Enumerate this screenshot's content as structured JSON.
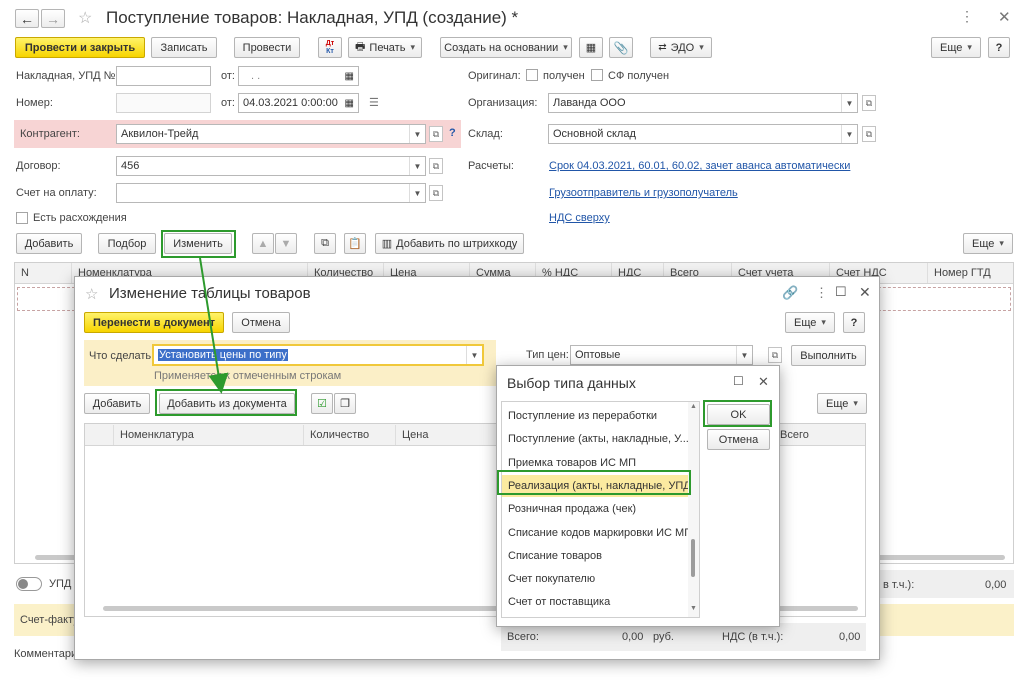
{
  "main": {
    "title": "Поступление товаров: Накладная, УПД (создание) *",
    "toolbar": {
      "post_close": "Провести и закрыть",
      "save": "Записать",
      "post": "Провести",
      "print": "Печать",
      "create_based": "Создать на основании",
      "edo": "ЭДО",
      "more": "Еще",
      "help": "?",
      "dtkt_top": "Дт",
      "dtkt_bottom": "Кт"
    },
    "fields": {
      "invoice_label": "Накладная, УПД №:",
      "invoice_value": "",
      "from_label": "от:",
      "invoice_date": ". .",
      "number_label": "Номер:",
      "number_value": "",
      "date_value": "04.03.2021 0:00:00",
      "counterparty_label": "Контрагент:",
      "counterparty_value": "Аквилон-Трейд",
      "contract_label": "Договор:",
      "contract_value": "456",
      "payment_invoice_label": "Счет на оплату:",
      "payment_invoice_value": "",
      "discrepancies_label": "Есть расхождения",
      "original_label": "Оригинал:",
      "received_label": "получен",
      "sf_received_label": "СФ получен",
      "organization_label": "Организация:",
      "organization_value": "Лаванда ООО",
      "warehouse_label": "Склад:",
      "warehouse_value": "Основной склад",
      "settlements_label": "Расчеты:",
      "settlements_link": "Срок 04.03.2021, 60.01, 60.02, зачет аванса автоматически",
      "shipper_link": "Грузоотправитель и грузополучатель",
      "vat_link": "НДС сверху",
      "question_mark": "?"
    },
    "table_toolbar": {
      "add": "Добавить",
      "select": "Подбор",
      "change": "Изменить",
      "add_barcode": "Добавить по штрихкоду",
      "more": "Еще"
    },
    "table_headers": [
      "N",
      "Номенклатура",
      "Количество",
      "Цена",
      "Сумма",
      "% НДС",
      "НДС",
      "Всего",
      "Счет учета",
      "Счет НДС",
      "Номер ГТД"
    ],
    "bottom": {
      "upd_label": "УПД",
      "vat_incl_label": "в т.ч.):",
      "vat_incl_value": "0,00",
      "invoice_label": "Счет-факту",
      "comment_label": "Комментари"
    }
  },
  "dialog1": {
    "title": "Изменение таблицы товаров",
    "transfer": "Перенести в документ",
    "cancel": "Отмена",
    "more": "Еще",
    "help": "?",
    "action_label": "Что сделать:",
    "action_value": "Установить цены по типу",
    "applies_hint": "Применяется к отмеченным строкам",
    "price_type_label": "Тип цен:",
    "price_type_value": "Оптовые",
    "execute": "Выполнить",
    "add": "Добавить",
    "add_from_doc": "Добавить из документа",
    "more2": "Еще",
    "headers": [
      "Номенклатура",
      "Количество",
      "Цена",
      "Всего"
    ],
    "total_label": "Всего:",
    "total_value": "0,00",
    "currency": "руб.",
    "vat_label": "НДС (в т.ч.):",
    "vat_value": "0,00"
  },
  "dialog2": {
    "title": "Выбор типа данных",
    "ok": "OK",
    "cancel": "Отмена",
    "items": [
      "Поступление из переработки",
      "Поступление (акты, накладные, У...",
      "Приемка товаров ИС МП",
      "Реализация (акты, накладные, УПД)",
      "Розничная продажа (чек)",
      "Списание кодов маркировки ИС МП",
      "Списание товаров",
      "Счет покупателю",
      "Счет от поставщика"
    ],
    "selected_index": 3
  },
  "colors": {
    "accent_yellow": "#f7d400",
    "highlight_green": "#2d9a2d",
    "link_blue": "#2156a8",
    "error_pink": "#f7d4d4"
  }
}
